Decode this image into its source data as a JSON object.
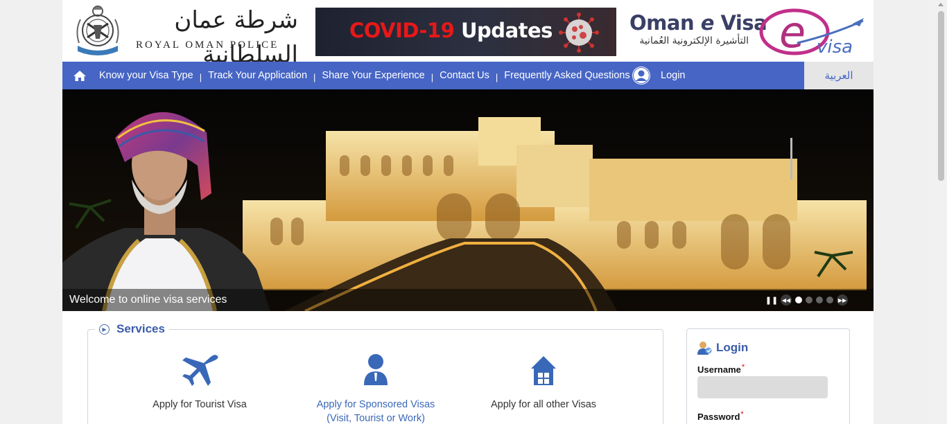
{
  "header": {
    "police_arabic": "شرطة عمان السلطانية",
    "police_english": "ROYAL OMAN POLICE",
    "covid_red": "COVID-19",
    "covid_white": " Updates",
    "evisa_title_1": "Oman ",
    "evisa_title_e": "e",
    "evisa_title_2": " Visa",
    "evisa_arabic": "التأشيرة الإلكترونية العُمانية",
    "evisa_logo_text": "visa"
  },
  "nav": {
    "items": [
      {
        "label": "Know your Visa Type"
      },
      {
        "label": "Track Your Application"
      },
      {
        "label": "Share Your Experience"
      },
      {
        "label": "Contact Us"
      },
      {
        "label": "Frequently Asked Questions"
      }
    ],
    "separator": "|",
    "login_label": "Login",
    "language_label": "العربية"
  },
  "slider": {
    "caption": "Welcome to online visa services",
    "pause_symbol": "❚❚",
    "prev_symbol": "◀◀",
    "next_symbol": "▶▶",
    "slide_count": 4,
    "active_slide": 1
  },
  "services": {
    "title": "Services",
    "items": [
      {
        "icon": "airplane-icon",
        "label": "Apply for Tourist Visa",
        "label_2": ""
      },
      {
        "icon": "person-icon",
        "label": "Apply for Sponsored Visas",
        "label_2": "(Visit, Tourist or Work)"
      },
      {
        "icon": "house-icon",
        "label": "Apply for all other Visas",
        "label_2": ""
      }
    ]
  },
  "login": {
    "title": "Login",
    "username_label": "Username",
    "password_label": "Password",
    "required_mark": "*"
  },
  "colors": {
    "nav_blue": "#4665c5",
    "link_blue": "#3a68b8",
    "title_blue": "#3a5ca8",
    "covid_red": "#e81818"
  }
}
